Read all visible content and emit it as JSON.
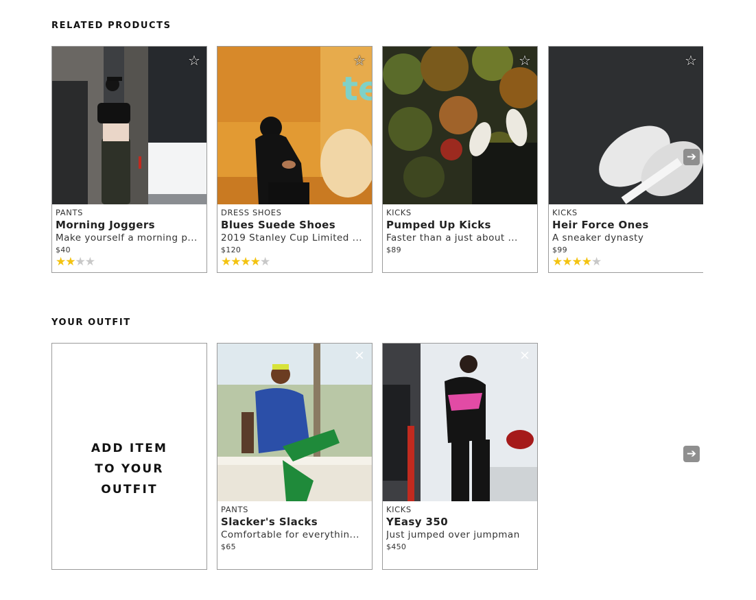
{
  "related": {
    "title": "RELATED PRODUCTS",
    "products": [
      {
        "category": "PANTS",
        "name": "Morning Joggers",
        "description": "Make yourself a morning p...",
        "price": "$40",
        "rating": 2,
        "rating_max": 4
      },
      {
        "category": "DRESS SHOES",
        "name": "Blues Suede Shoes",
        "description": "2019 Stanley Cup Limited ...",
        "price": "$120",
        "rating": 4,
        "rating_max": 5
      },
      {
        "category": "KICKS",
        "name": "Pumped Up Kicks",
        "description": "Faster than a just about ...",
        "price": "$89",
        "rating": null
      },
      {
        "category": "KICKS",
        "name": "Heir Force Ones",
        "description": "A sneaker dynasty",
        "price": "$99",
        "rating": 4,
        "rating_max": 5
      }
    ],
    "favorite_icon": "star-outline-icon",
    "next_icon": "arrow-right-icon"
  },
  "outfit": {
    "title": "YOUR OUTFIT",
    "add_item_lines": [
      "ADD ITEM",
      "TO YOUR",
      "OUTFIT"
    ],
    "products": [
      {
        "category": "PANTS",
        "name": "Slacker's Slacks",
        "description": "Comfortable for everythin...",
        "price": "$65"
      },
      {
        "category": "KICKS",
        "name": "YEasy 350",
        "description": "Just jumped over jumpman",
        "price": "$450"
      }
    ],
    "remove_icon": "close-x-icon",
    "next_icon": "arrow-right-icon"
  },
  "colors": {
    "star_filled": "#f3c311",
    "star_empty": "#c8c8c8",
    "border": "#9a9a9a",
    "arrow_bg": "#8a8a8a"
  }
}
